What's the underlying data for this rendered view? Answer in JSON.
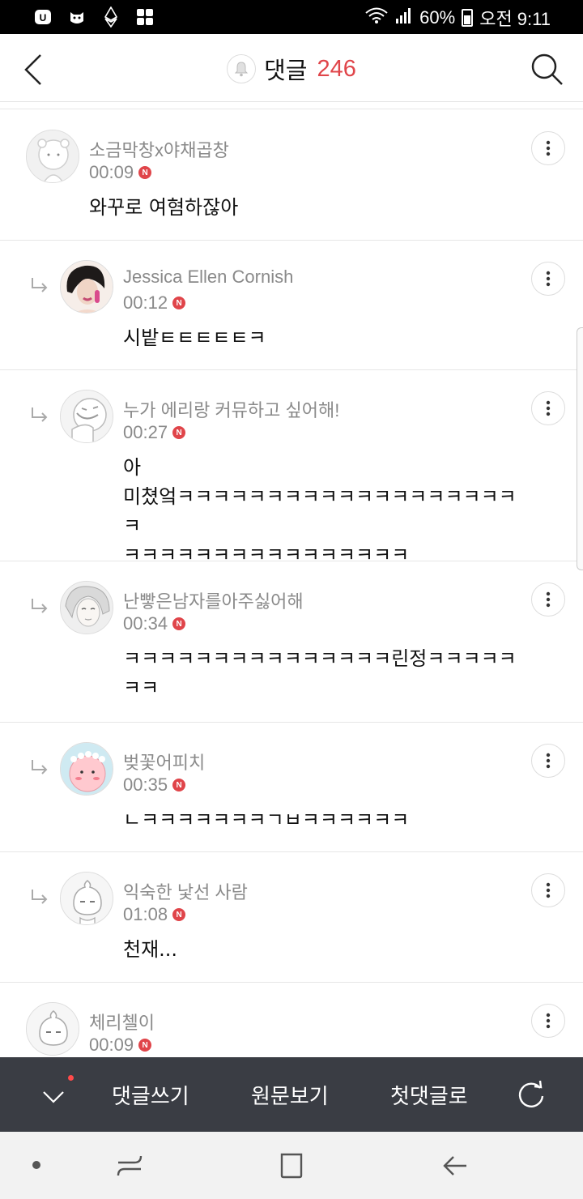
{
  "status_bar": {
    "battery": "60%",
    "time": "오전 9:11",
    "icons": [
      "uplus-icon",
      "cat-icon",
      "ethereum-icon",
      "app-grid-icon"
    ]
  },
  "header": {
    "title": "댓글",
    "count": "246",
    "back_icon": "chevron-left-icon",
    "bell_icon": "bell-icon",
    "search_icon": "search-icon"
  },
  "comments": [
    {
      "user": "소금막창x야채곱창",
      "time": "00:09",
      "badge": "N",
      "text": "와꾸로 여혐하잖아",
      "reply": false
    },
    {
      "user": "Jessica Ellen Cornish",
      "time": "00:12",
      "badge": "N",
      "text": "시밭ㅌㅌㅌㅌㅌㅋ",
      "reply": true
    },
    {
      "user": "누가 에리랑 커뮤하고 싶어해!",
      "time": "00:27",
      "badge": "N",
      "text": "아\n미쳤엌ㅋㅋㅋㅋㅋㅋㅋㅋㅋㅋㅋㅋㅋㅋㅋㅋㅋㅋㅋㅋ\nㅋㅋㅋㅋㅋㅋㅋㅋㅋㅋㅋㅋㅋㅋㅋㅋ",
      "reply": true
    },
    {
      "user": "난빻은남자를아주싫어해",
      "time": "00:34",
      "badge": "N",
      "text": "ㅋㅋㅋㅋㅋㅋㅋㅋㅋㅋㅋㅋㅋㅋㅋ린정ㅋㅋㅋㅋㅋ\nㅋㅋ",
      "reply": true
    },
    {
      "user": "벚꽃어피치",
      "time": "00:35",
      "badge": "N",
      "text": "ㄴㅋㅋㅋㅋㅋㅋㅋㄱㅂㅋㅋㅋㅋㅋㅋ",
      "reply": true
    },
    {
      "user": "익숙한 낯선 사람",
      "time": "01:08",
      "badge": "N",
      "text": "천재...",
      "reply": true
    },
    {
      "user": "체리첼이",
      "time": "00:09",
      "badge": "N",
      "text": "",
      "reply": false
    }
  ],
  "action_bar": {
    "write": "댓글쓰기",
    "original": "원문보기",
    "first": "첫댓글로",
    "collapse_icon": "chevron-down-icon",
    "refresh_icon": "refresh-icon"
  },
  "colors": {
    "accent": "#e0454a",
    "action_bar_bg": "#3a3d44",
    "meta_text": "#8a8a8a"
  }
}
